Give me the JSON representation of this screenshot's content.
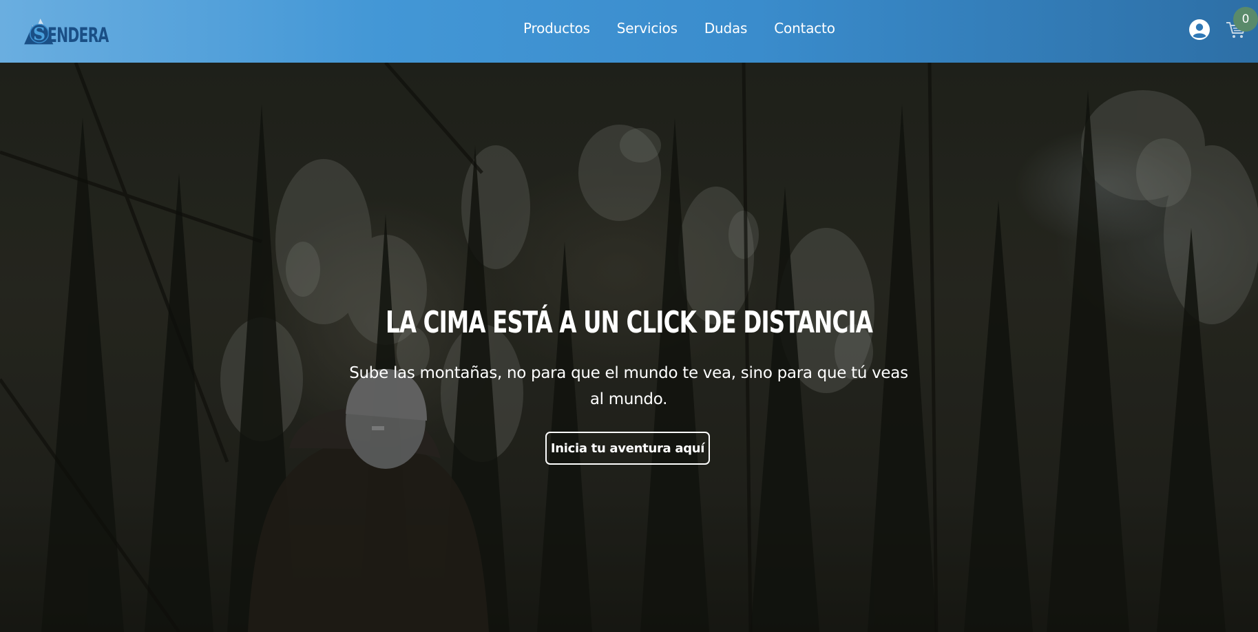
{
  "header": {
    "logo_text": "ENDERA",
    "logo_initial": "S",
    "nav": [
      {
        "label": "Productos"
      },
      {
        "label": "Servicios"
      },
      {
        "label": "Dudas"
      },
      {
        "label": "Contacto"
      }
    ],
    "cart_count": "0",
    "icons": {
      "user": "user-circle-icon",
      "cart": "shopping-cart-icon"
    }
  },
  "hero": {
    "title": "LA CIMA ESTÁ A UN CLICK DE DISTANCIA",
    "subtitle": "Sube las montañas, no para que el mundo te vea, sino para que tú veas al mundo.",
    "cta_label": "Inicia tu aventura aquí"
  },
  "colors": {
    "navbar_start": "#6aaee0",
    "navbar_end": "#2d6fa6",
    "logo": "#1a4f86",
    "badge": "#5a8a6a",
    "text": "#ffffff"
  }
}
